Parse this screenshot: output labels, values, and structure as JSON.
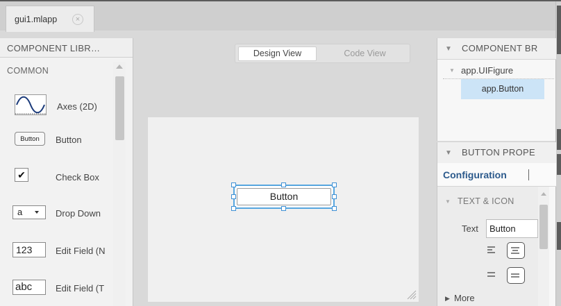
{
  "tab": {
    "filename": "gui1.mlapp",
    "close_glyph": "×"
  },
  "library": {
    "header": "COMPONENT LIBR…",
    "section": "COMMON",
    "items": [
      {
        "label": "Axes (2D)",
        "icon": "axes-icon"
      },
      {
        "label": "Button",
        "icon": "button-icon",
        "icon_text": "Button"
      },
      {
        "label": "Check Box",
        "icon": "checkbox-icon",
        "icon_text": "✔"
      },
      {
        "label": "Drop Down",
        "icon": "dropdown-icon",
        "icon_text": "a"
      },
      {
        "label": "Edit Field (N",
        "icon": "numeric-field-icon",
        "icon_text": "123"
      },
      {
        "label": "Edit Field (T",
        "icon": "text-field-icon",
        "icon_text": "abc"
      }
    ]
  },
  "views": {
    "design": "Design View",
    "code": "Code View",
    "active": "design"
  },
  "canvas": {
    "button_label": "Button"
  },
  "browser": {
    "header": "COMPONENT BR",
    "tree": [
      {
        "label": "app.UIFigure",
        "level": 0
      },
      {
        "label": "app.Button",
        "level": 1,
        "selected": true
      }
    ]
  },
  "properties": {
    "header": "BUTTON PROPE",
    "tab": "Configuration",
    "section": "TEXT & ICON",
    "text_label": "Text",
    "text_value": "Button",
    "more": "More"
  },
  "colors": {
    "selection": "#56a6df",
    "tree_selected": "#cce4f7",
    "config_tab": "#2c5a8c"
  }
}
